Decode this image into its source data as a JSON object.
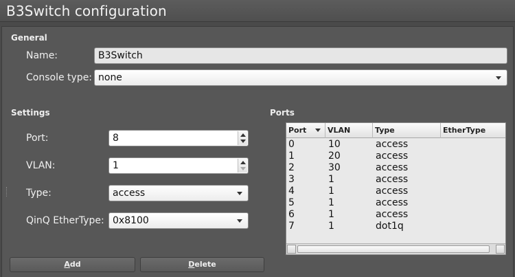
{
  "window": {
    "title": "B3Switch configuration"
  },
  "general": {
    "section_label": "General",
    "name_label": "Name:",
    "name_value": "B3Switch",
    "console_label": "Console type:",
    "console_value": "none"
  },
  "settings": {
    "section_label": "Settings",
    "port_label": "Port:",
    "port_value": "8",
    "vlan_label": "VLAN:",
    "vlan_value": "1",
    "type_label": "Type:",
    "type_value": "access",
    "ethertype_label": "QinQ EtherType:",
    "ethertype_value": "0x8100"
  },
  "ports": {
    "section_label": "Ports",
    "columns": [
      "Port",
      "VLAN",
      "Type",
      "EtherType"
    ],
    "rows": [
      [
        "0",
        "10",
        "access",
        ""
      ],
      [
        "1",
        "20",
        "access",
        ""
      ],
      [
        "2",
        "30",
        "access",
        ""
      ],
      [
        "3",
        "1",
        "access",
        ""
      ],
      [
        "4",
        "1",
        "access",
        ""
      ],
      [
        "5",
        "1",
        "access",
        ""
      ],
      [
        "6",
        "1",
        "access",
        ""
      ],
      [
        "7",
        "1",
        "dot1q",
        ""
      ]
    ]
  },
  "buttons": {
    "add_first": "A",
    "add_rest": "dd",
    "delete_first": "D",
    "delete_rest": "elete"
  },
  "icons": {
    "dropdown": "chevron-down-icon",
    "spin": "spinner-arrows-icon",
    "sort": "sort-descending-icon"
  }
}
